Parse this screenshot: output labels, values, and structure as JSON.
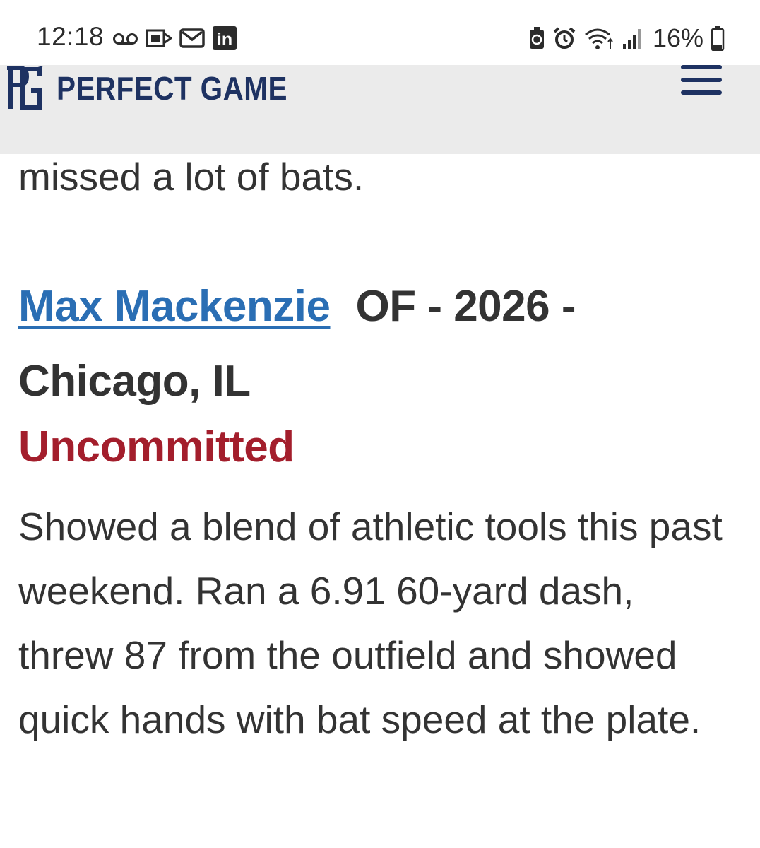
{
  "status_bar": {
    "time": "12:18",
    "left_icons": [
      "voicemail-icon",
      "wallet-icon",
      "mail-icon",
      "linkedin-icon"
    ],
    "right_icons": [
      "battery-saver-icon",
      "alarm-icon",
      "wifi-icon",
      "signal-icon",
      "battery-icon"
    ],
    "battery_percent": "16%",
    "linkedin_label": "in"
  },
  "header": {
    "brand": "PERFECT GAME",
    "logo": "PG",
    "brand_color": "#1e3262"
  },
  "article": {
    "previous_text_tail": "missed a lot of bats.",
    "player": {
      "name": "Max Mackenzie",
      "details": "OF - 2026 - Chicago, IL",
      "commitment": "Uncommitted",
      "report": "Showed a blend of athletic tools this past weekend. Ran a 6.91 60-yard dash, threw 87 from the outfield and showed quick hands with bat speed at the plate."
    }
  },
  "colors": {
    "link": "#2a6eb4",
    "uncommitted": "#a31e2c",
    "header_bg": "#ebebeb",
    "text": "#333333"
  }
}
